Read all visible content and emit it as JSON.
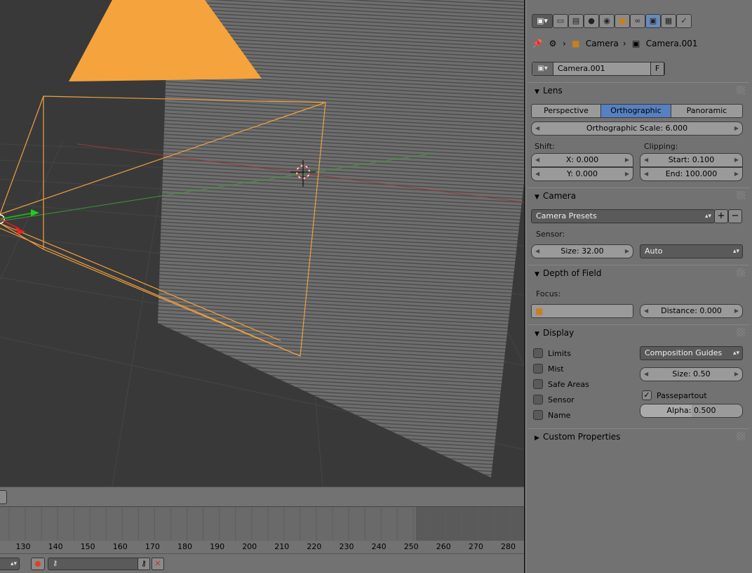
{
  "viewport": {
    "colors": {
      "object_orange": "#f5a33c",
      "camera_frame": "#f0a040",
      "grid": "#4a4a4a",
      "plane": "#6c6c6c"
    }
  },
  "timeline": {
    "ticks": [
      "130",
      "140",
      "150",
      "160",
      "170",
      "180",
      "190",
      "200",
      "210",
      "220",
      "230",
      "240",
      "250",
      "260",
      "270",
      "280"
    ]
  },
  "props": {
    "tab_icons": [
      "render-icon",
      "render-layers-icon",
      "scene-icon",
      "world-icon",
      "object-icon",
      "constraints-icon",
      "camera-data-icon",
      "texture-icon",
      "physics-icon"
    ],
    "breadcrumb": {
      "object": "Camera",
      "data": "Camera.001"
    },
    "datablock": {
      "name": "Camera.001",
      "fake_user": "F"
    },
    "lens": {
      "header": "Lens",
      "types": [
        "Perspective",
        "Orthographic",
        "Panoramic"
      ],
      "active_type": "Orthographic",
      "ortho_scale": "Orthographic Scale: 6.000",
      "shift_label": "Shift:",
      "shift_x": "X: 0.000",
      "shift_y": "Y: 0.000",
      "clipping_label": "Clipping:",
      "clip_start": "Start: 0.100",
      "clip_end": "End: 100.000"
    },
    "camera": {
      "header": "Camera",
      "presets": "Camera Presets",
      "sensor_label": "Sensor:",
      "sensor_size": "Size: 32.00",
      "sensor_fit": "Auto"
    },
    "dof": {
      "header": "Depth of Field",
      "focus_label": "Focus:",
      "distance": "Distance: 0.000"
    },
    "display": {
      "header": "Display",
      "checks": [
        {
          "label": "Limits",
          "checked": false
        },
        {
          "label": "Mist",
          "checked": false
        },
        {
          "label": "Safe Areas",
          "checked": false
        },
        {
          "label": "Sensor",
          "checked": false
        },
        {
          "label": "Name",
          "checked": false
        }
      ],
      "guides": "Composition Guides",
      "size": "Size: 0.50",
      "passepartout_label": "Passepartout",
      "passepartout_checked": true,
      "alpha": "Alpha: 0.500",
      "alpha_value": 0.5
    },
    "custom": {
      "header": "Custom Properties"
    }
  }
}
